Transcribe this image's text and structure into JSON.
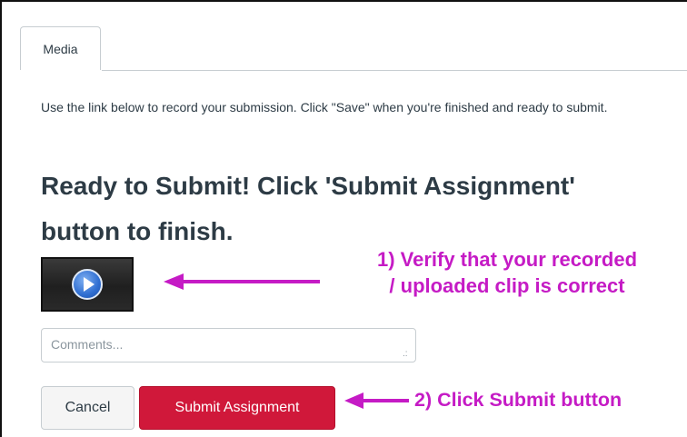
{
  "tabs": [
    {
      "label": "Media"
    }
  ],
  "instructions": "Use the link below to record your submission. Click \"Save\" when you're finished and ready to submit.",
  "heading": "Ready to Submit! Click 'Submit Assignment' button to finish.",
  "media": {
    "icon": "play-icon"
  },
  "comments": {
    "placeholder": "Comments...",
    "value": ""
  },
  "buttons": {
    "cancel": "Cancel",
    "submit": "Submit Assignment"
  },
  "annotations": {
    "step1_line1": "1) Verify that your recorded",
    "step1_line2": "/ uploaded clip is correct",
    "step2": "2) Click Submit button"
  },
  "colors": {
    "accent": "#d0183a",
    "annotation": "#c51bc5",
    "text": "#2d3b45"
  }
}
